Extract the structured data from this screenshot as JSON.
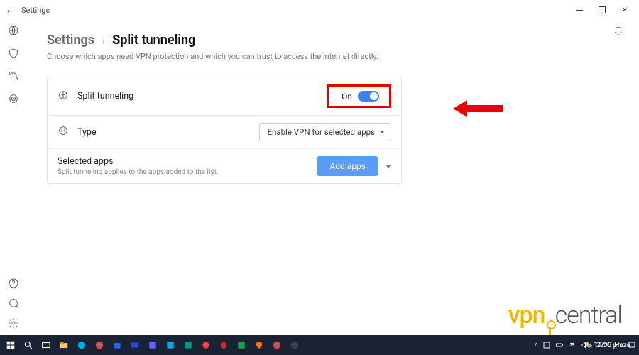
{
  "window": {
    "title": "Settings",
    "controls": {
      "minimize": "—",
      "maximize": "▢",
      "close": "✕"
    }
  },
  "breadcrumb": {
    "root": "Settings",
    "sep": "›",
    "page": "Split tunneling"
  },
  "subtitle": "Choose which apps need VPN protection and which you can trust to access the internet directly.",
  "rows": {
    "split": {
      "label": "Split tunneling",
      "toggle_text": "On"
    },
    "type": {
      "label": "Type",
      "dropdown": "Enable VPN for selected apps"
    },
    "selected": {
      "label": "Selected apps",
      "sub": "Split tunneling applies to the apps added to the list.",
      "button": "Add apps"
    }
  },
  "logo": {
    "part1": "vpn",
    "part2": "central"
  },
  "taskbar": {
    "weather_temp": "27°C",
    "weather_text": "Haze",
    "time": "11:06 pm"
  }
}
